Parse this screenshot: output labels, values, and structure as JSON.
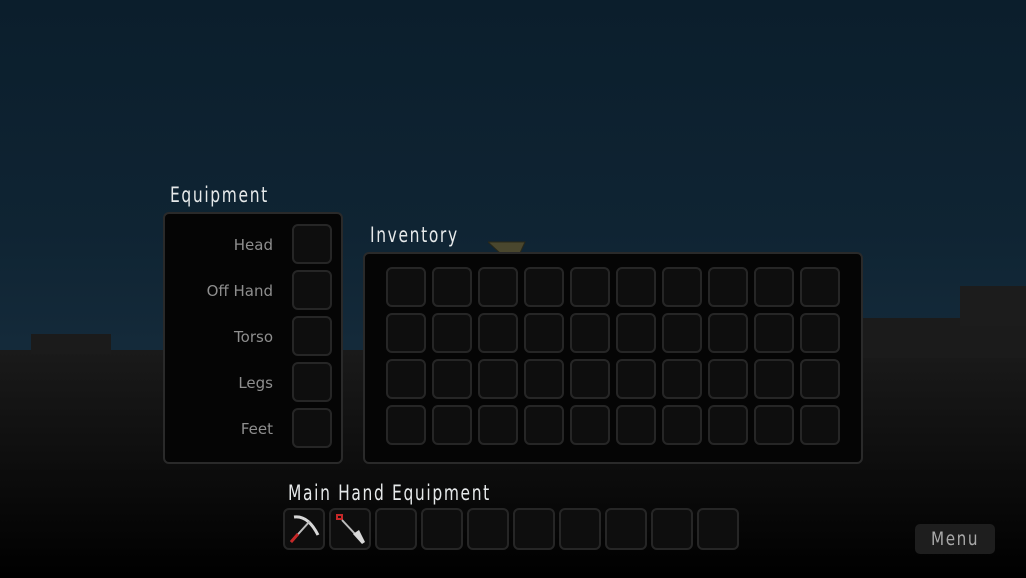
{
  "equipment": {
    "title": "Equipment",
    "slots": [
      {
        "label": "Head"
      },
      {
        "label": "Off Hand"
      },
      {
        "label": "Torso"
      },
      {
        "label": "Legs"
      },
      {
        "label": "Feet"
      }
    ]
  },
  "inventory": {
    "title": "Inventory",
    "rows": 4,
    "cols": 10
  },
  "main_hand": {
    "title": "Main Hand Equipment",
    "slots": [
      {
        "item": "pickaxe"
      },
      {
        "item": "shovel"
      },
      {
        "item": ""
      },
      {
        "item": ""
      },
      {
        "item": ""
      },
      {
        "item": ""
      },
      {
        "item": ""
      },
      {
        "item": ""
      },
      {
        "item": ""
      },
      {
        "item": ""
      }
    ]
  },
  "menu": {
    "label": "Menu"
  }
}
